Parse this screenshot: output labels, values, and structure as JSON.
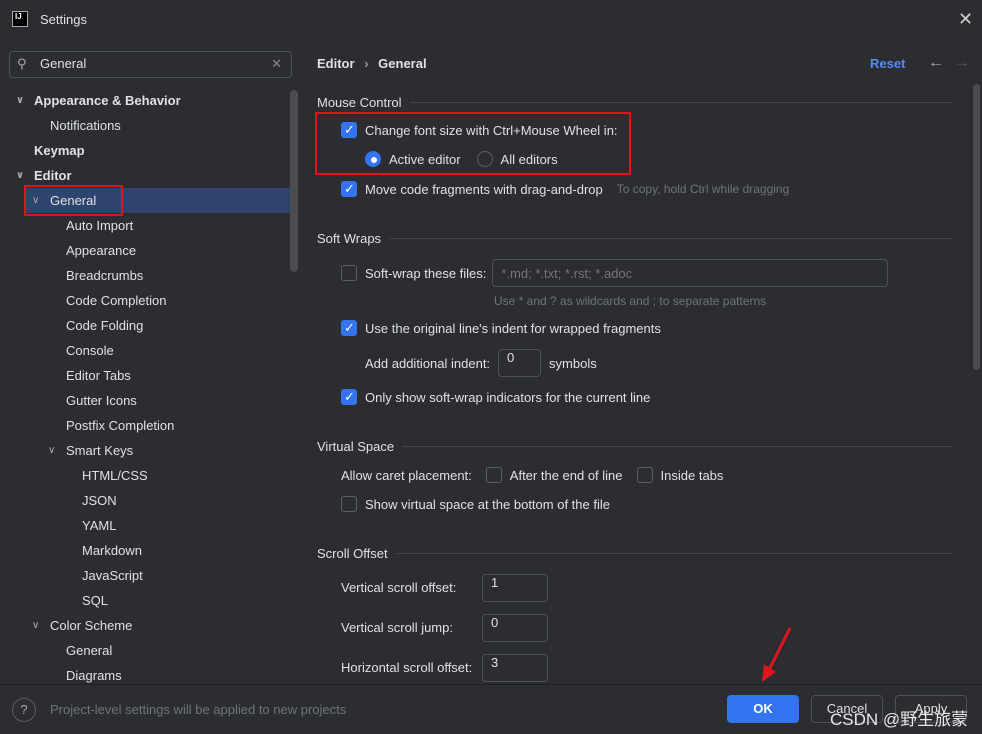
{
  "window": {
    "title": "Settings",
    "logo": "IJ"
  },
  "search": {
    "value": "General"
  },
  "tree": [
    {
      "label": "Appearance & Behavior",
      "level": 0,
      "bold": true,
      "chevron": "down"
    },
    {
      "label": "Notifications",
      "level": 1
    },
    {
      "label": "Keymap",
      "level": 0,
      "bold": true
    },
    {
      "label": "Editor",
      "level": 0,
      "bold": true,
      "chevron": "down"
    },
    {
      "label": "General",
      "level": 1,
      "chevron": "down",
      "selected": true
    },
    {
      "label": "Auto Import",
      "level": 2
    },
    {
      "label": "Appearance",
      "level": 2
    },
    {
      "label": "Breadcrumbs",
      "level": 2
    },
    {
      "label": "Code Completion",
      "level": 2
    },
    {
      "label": "Code Folding",
      "level": 2
    },
    {
      "label": "Console",
      "level": 2
    },
    {
      "label": "Editor Tabs",
      "level": 2
    },
    {
      "label": "Gutter Icons",
      "level": 2
    },
    {
      "label": "Postfix Completion",
      "level": 2
    },
    {
      "label": "Smart Keys",
      "level": 2,
      "chevron": "down"
    },
    {
      "label": "HTML/CSS",
      "level": 3
    },
    {
      "label": "JSON",
      "level": 3
    },
    {
      "label": "YAML",
      "level": 3
    },
    {
      "label": "Markdown",
      "level": 3
    },
    {
      "label": "JavaScript",
      "level": 3
    },
    {
      "label": "SQL",
      "level": 3
    },
    {
      "label": "Color Scheme",
      "level": 1,
      "chevron": "down"
    },
    {
      "label": "General",
      "level": 2
    },
    {
      "label": "Diagrams",
      "level": 2
    }
  ],
  "header": {
    "crumb1": "Editor",
    "sep": "›",
    "crumb2": "General",
    "reset": "Reset",
    "back": "←",
    "forward": "→"
  },
  "mouse": {
    "title": "Mouse Control",
    "font_size": "Change font size with Ctrl+Mouse Wheel in:",
    "active": "Active editor",
    "all": "All editors",
    "drag": "Move code fragments with drag-and-drop",
    "drag_hint": "To copy, hold Ctrl while dragging"
  },
  "soft": {
    "title": "Soft Wraps",
    "files": "Soft-wrap these files:",
    "files_placeholder": "*.md; *.txt; *.rst; *.adoc",
    "files_hint": "Use * and ? as wildcards and ; to separate patterns",
    "indent": "Use the original line's indent for wrapped fragments",
    "add_indent": "Add additional indent:",
    "add_indent_value": "0",
    "symbols": "symbols",
    "only_current": "Only show soft-wrap indicators for the current line"
  },
  "virtual": {
    "title": "Virtual Space",
    "caret": "Allow caret placement:",
    "after_end": "After the end of line",
    "inside_tabs": "Inside tabs",
    "bottom": "Show virtual space at the bottom of the file"
  },
  "scroll": {
    "title": "Scroll Offset",
    "vso": "Vertical scroll offset:",
    "vso_value": "1",
    "vsj": "Vertical scroll jump:",
    "vsj_value": "0",
    "hso": "Horizontal scroll offset:",
    "hso_value": "3"
  },
  "footer": {
    "help": "?",
    "note": "Project-level settings will be applied to new projects",
    "ok": "OK",
    "cancel": "Cancel",
    "apply": "Apply",
    "watermark": "CSDN @野生旅蒙"
  },
  "colors": {
    "accent": "#3574f0",
    "highlight": "#e0141e",
    "selection": "#2e436e"
  }
}
